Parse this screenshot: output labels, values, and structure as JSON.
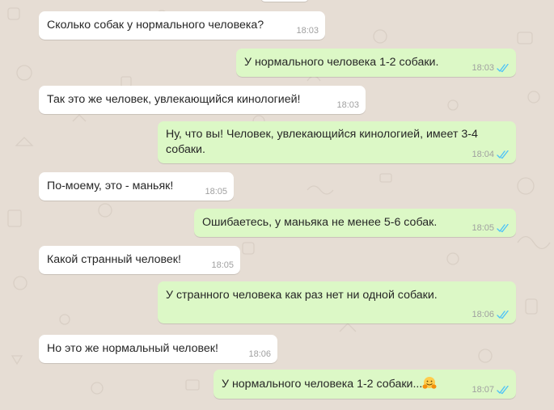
{
  "chat": {
    "colors": {
      "background": "#e6ddd4",
      "incoming_bubble": "#ffffff",
      "outgoing_bubble": "#dcf8c6",
      "read_ticks": "#4fc3f7",
      "timestamp": "#a0a0a0"
    },
    "messages": [
      {
        "direction": "in",
        "text": "Сколько собак у нормального человека?",
        "time": "18:03"
      },
      {
        "direction": "out",
        "text": "У нормального человека 1-2 собаки.",
        "time": "18:03",
        "status": "read"
      },
      {
        "direction": "in",
        "text": "Так это же человек, увлекающийся кинологией!",
        "time": "18:03"
      },
      {
        "direction": "out",
        "text": "Ну, что вы! Человек, увлекающийся кинологией, имеет 3-4 собаки.",
        "time": "18:04",
        "status": "read"
      },
      {
        "direction": "in",
        "text": "По-моему, это - маньяк!",
        "time": "18:05"
      },
      {
        "direction": "out",
        "text": "Ошибаетесь, у маньяка не менее 5-6 собак.",
        "time": "18:05",
        "status": "read"
      },
      {
        "direction": "in",
        "text": "Какой странный человек!",
        "time": "18:05"
      },
      {
        "direction": "out",
        "text": "У странного человека как раз нет ни одной собаки.",
        "time": "18:06",
        "status": "read"
      },
      {
        "direction": "in",
        "text": "Но это же нормальный человек!",
        "time": "18:06"
      },
      {
        "direction": "out",
        "text": "У нормального человека 1-2 собаки...",
        "time": "18:07",
        "status": "read",
        "emoji": "hugging-face-emoji"
      }
    ]
  }
}
